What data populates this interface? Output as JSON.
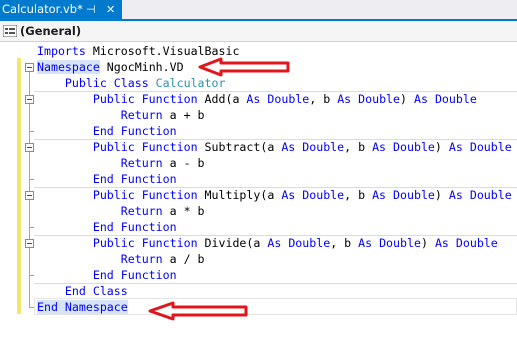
{
  "tab": {
    "title": "Calculator.vb*",
    "pin_icon": "pin-icon",
    "close_icon": "close-icon"
  },
  "navbar": {
    "label": "(General)",
    "icon": "vb-class-icon"
  },
  "code": {
    "imports": {
      "kw": "Imports",
      "rest": " Microsoft.VisualBasic"
    },
    "namespace_open": {
      "kw": "Namespace",
      "name": " NgocMinh.VD"
    },
    "class_open": {
      "kw": "Public Class ",
      "name": "Calculator"
    },
    "functions": [
      {
        "name": "Add",
        "op": "+"
      },
      {
        "name": "Subtract",
        "op": "-"
      },
      {
        "name": "Multiply",
        "op": "*"
      },
      {
        "name": "Divide",
        "op": "/"
      }
    ],
    "kw_public_function": "Public Function",
    "kw_as": "As",
    "kw_double": "Double",
    "kw_return": "Return",
    "kw_end_function": "End Function",
    "end_class": "End Class",
    "end_namespace": "End Namespace"
  },
  "annotations": {
    "arrow_color": "#e0161c"
  },
  "colors": {
    "keyword": "#0000ff",
    "type": "#2b91af",
    "tab_active": "#007acc",
    "change_margin": "#f2e66d"
  }
}
